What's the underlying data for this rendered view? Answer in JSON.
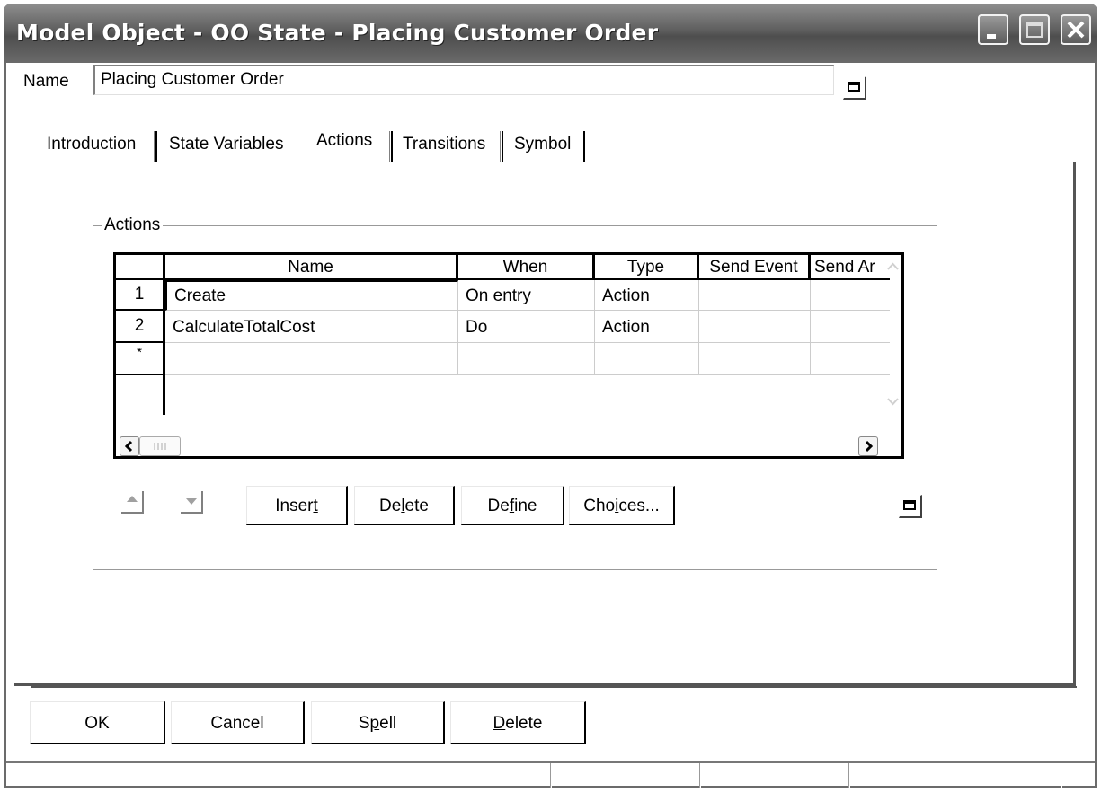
{
  "window": {
    "title": "Model Object - OO State - Placing Customer Order"
  },
  "name_field": {
    "label": "Name",
    "value": "Placing Customer Order"
  },
  "tabs": [
    {
      "label": "Introduction",
      "selected": false
    },
    {
      "label": "State Variables",
      "selected": false
    },
    {
      "label": "Actions",
      "selected": true
    },
    {
      "label": "Transitions",
      "selected": false
    },
    {
      "label": "Symbol",
      "selected": false
    }
  ],
  "actions_group": {
    "title": "Actions",
    "columns": [
      "Name",
      "When",
      "Type",
      "Send Event",
      "Send Ar"
    ],
    "rows": [
      {
        "num": "1",
        "name": "Create",
        "when": "On entry",
        "type": "Action",
        "send_event": "",
        "send_arg": ""
      },
      {
        "num": "2",
        "name": "CalculateTotalCost",
        "when": "Do",
        "type": "Action",
        "send_event": "",
        "send_arg": ""
      }
    ],
    "new_row_marker": "*",
    "buttons": {
      "insert_pre": "Inser",
      "insert_u": "t",
      "insert_post": "",
      "delete_pre": "De",
      "delete_u": "l",
      "delete_post": "ete",
      "define_pre": "De",
      "define_u": "f",
      "define_post": "ine",
      "choices_pre": "Cho",
      "choices_u": "i",
      "choices_post": "ces..."
    }
  },
  "footer_buttons": {
    "ok": "OK",
    "cancel": "Cancel",
    "spell_pre": "S",
    "spell_u": "p",
    "spell_post": "ell",
    "delete_pre": "",
    "delete_u": "D",
    "delete_post": "elete"
  },
  "colors": {
    "titlebar": "#5e5e5e",
    "title_text": "#ffffff"
  }
}
